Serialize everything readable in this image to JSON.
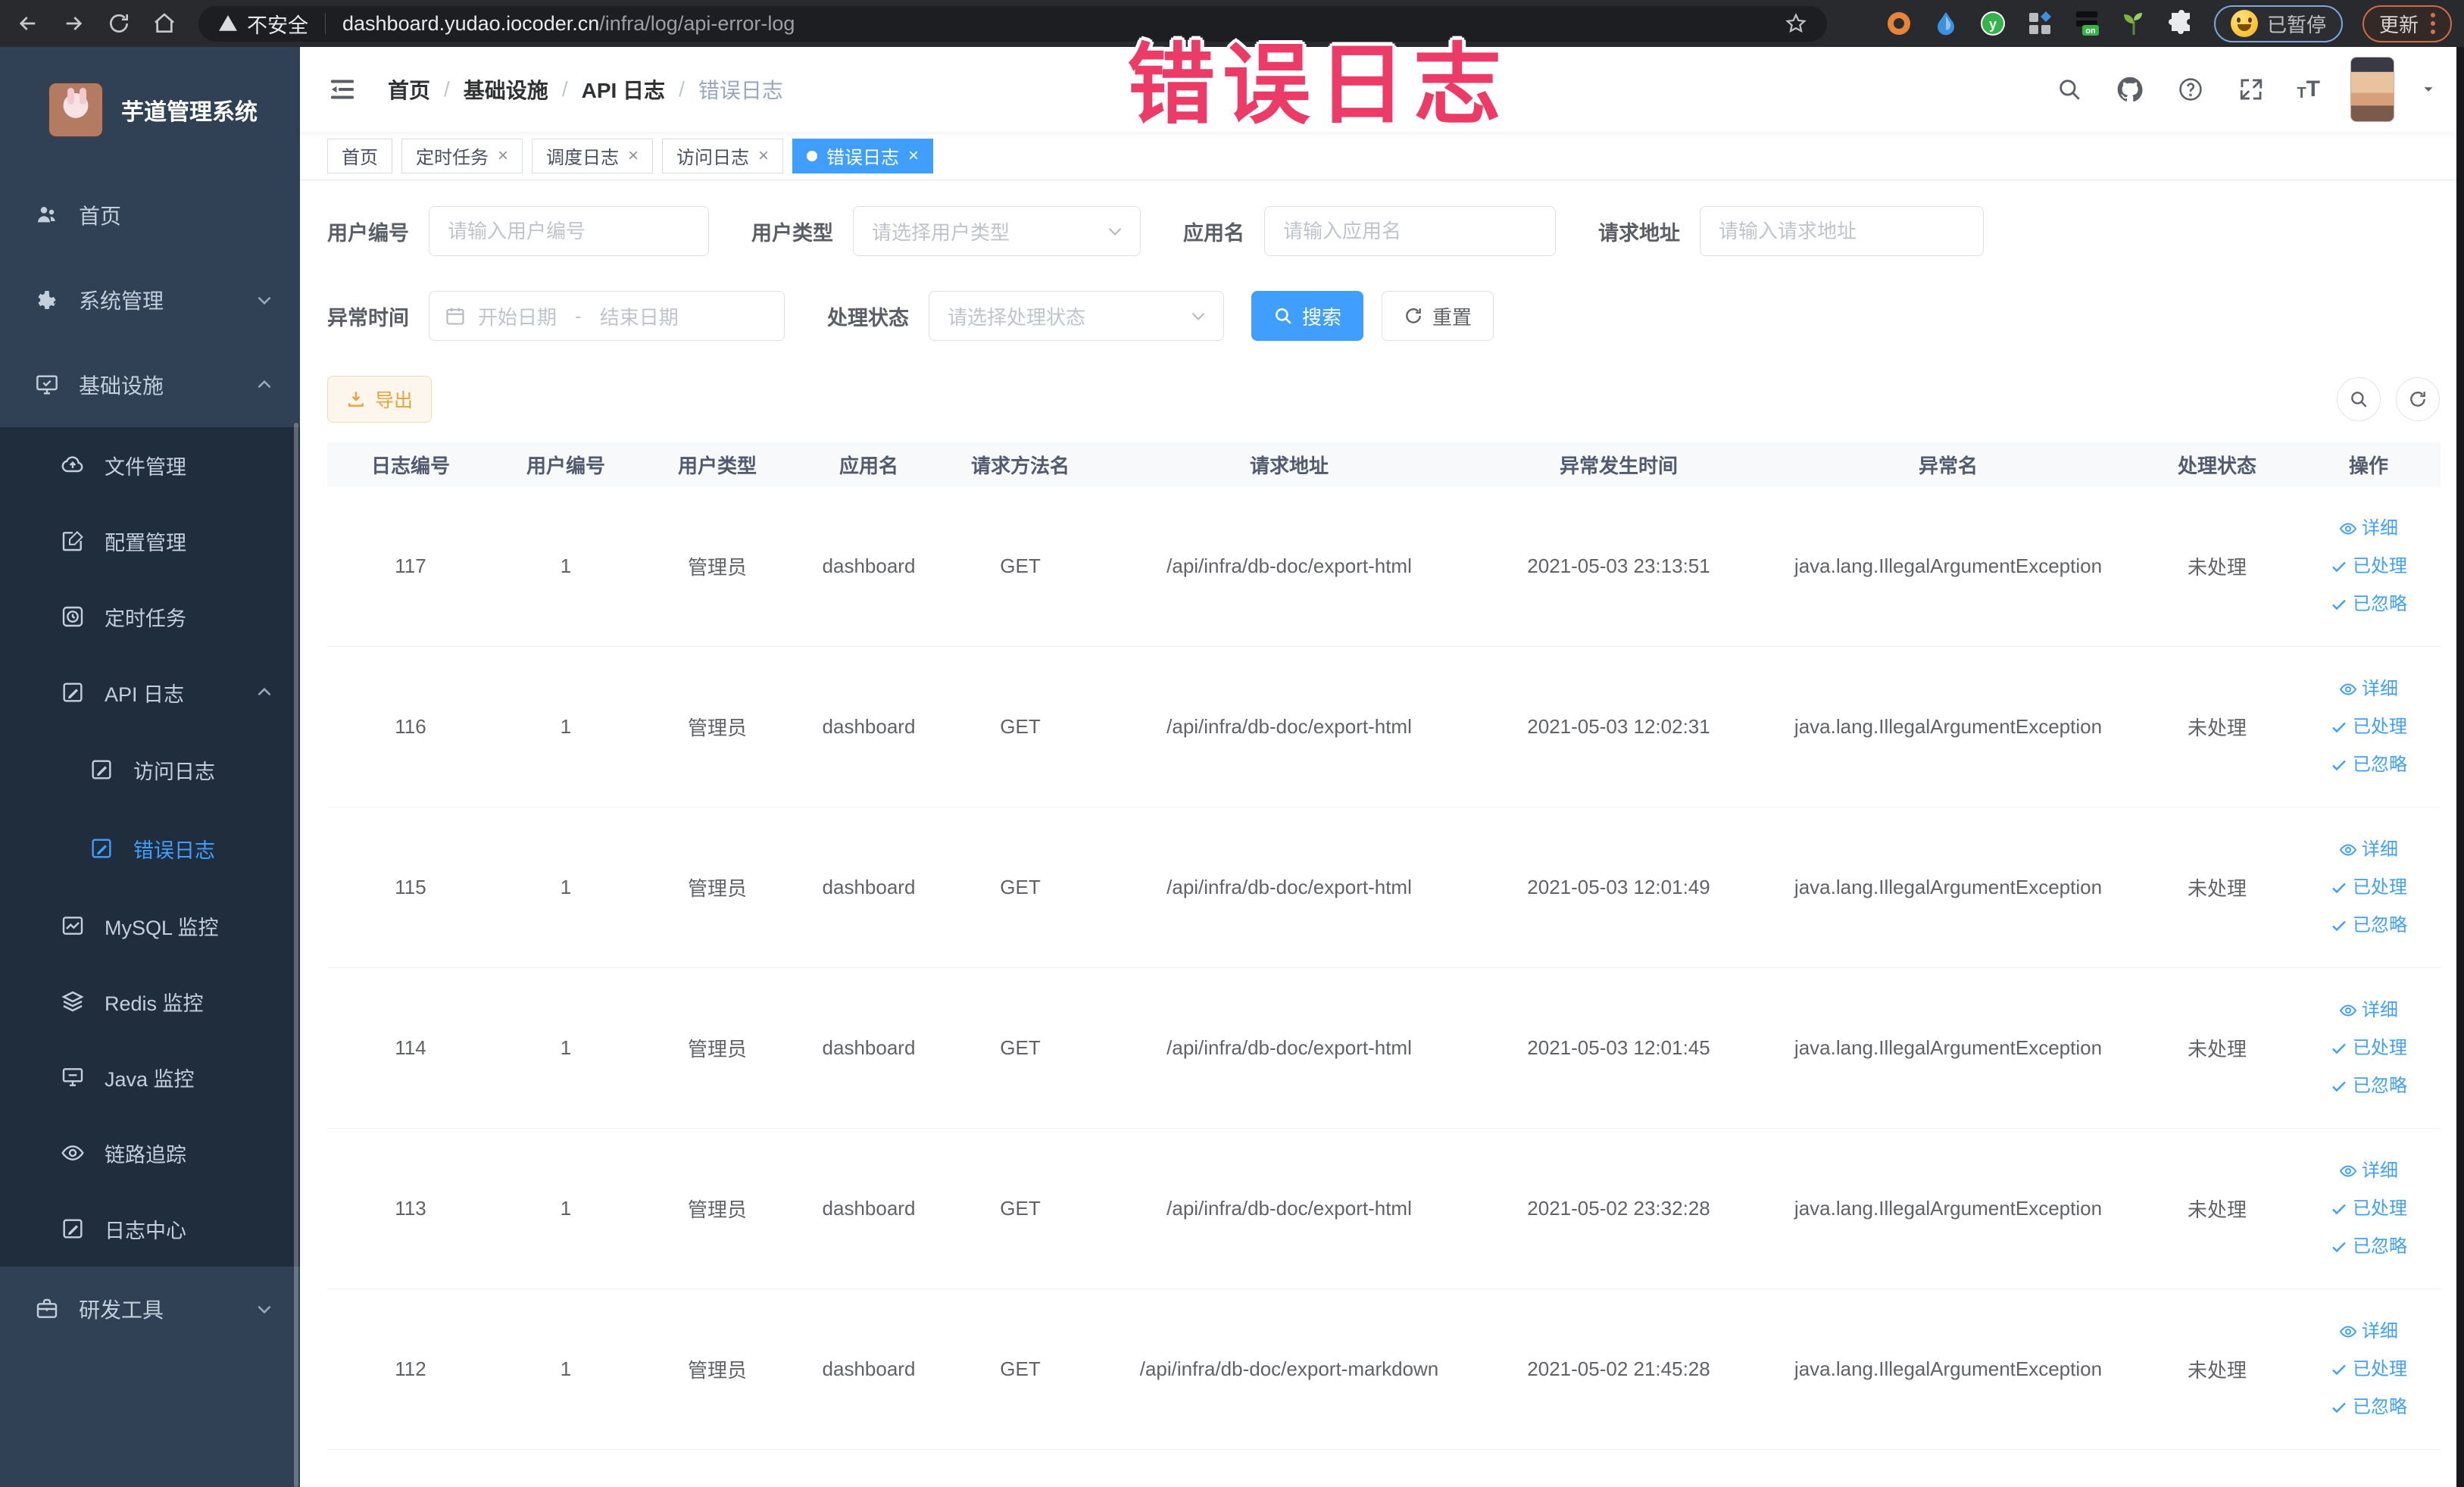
{
  "browser": {
    "security_label": "不安全",
    "url_domain": "dashboard.yudao.iocoder.cn",
    "url_path": "/infra/log/api-error-log",
    "paused_label": "已暂停",
    "update_label": "更新"
  },
  "watermark": {
    "text": "错误日志"
  },
  "sidebar": {
    "logo_title": "芋道管理系统",
    "items": [
      {
        "label": "首页"
      },
      {
        "label": "系统管理"
      },
      {
        "label": "基础设施"
      },
      {
        "label": "文件管理"
      },
      {
        "label": "配置管理"
      },
      {
        "label": "定时任务"
      },
      {
        "label": "API 日志"
      },
      {
        "label": "访问日志"
      },
      {
        "label": "错误日志"
      },
      {
        "label": "MySQL 监控"
      },
      {
        "label": "Redis 监控"
      },
      {
        "label": "Java 监控"
      },
      {
        "label": "链路追踪"
      },
      {
        "label": "日志中心"
      },
      {
        "label": "研发工具"
      }
    ]
  },
  "header": {
    "breadcrumb": [
      "首页",
      "基础设施",
      "API 日志",
      "错误日志"
    ]
  },
  "tabs": [
    {
      "label": "首页"
    },
    {
      "label": "定时任务"
    },
    {
      "label": "调度日志"
    },
    {
      "label": "访问日志"
    },
    {
      "label": "错误日志"
    }
  ],
  "filters": {
    "user_id_label": "用户编号",
    "user_id_placeholder": "请输入用户编号",
    "user_type_label": "用户类型",
    "user_type_placeholder": "请选择用户类型",
    "app_name_label": "应用名",
    "app_name_placeholder": "请输入应用名",
    "request_url_label": "请求地址",
    "request_url_placeholder": "请输入请求地址",
    "exception_time_label": "异常时间",
    "start_date_placeholder": "开始日期",
    "date_separator": "-",
    "end_date_placeholder": "结束日期",
    "process_status_label": "处理状态",
    "process_status_placeholder": "请选择处理状态",
    "search_label": "搜索",
    "reset_label": "重置"
  },
  "toolbar": {
    "export_label": "导出"
  },
  "table": {
    "headers": [
      "日志编号",
      "用户编号",
      "用户类型",
      "应用名",
      "请求方法名",
      "请求地址",
      "异常发生时间",
      "异常名",
      "处理状态",
      "操作"
    ],
    "action_labels": {
      "detail": "详细",
      "processed": "已处理",
      "ignored": "已忽略"
    },
    "rows": [
      {
        "id": "117",
        "user_id": "1",
        "user_type": "管理员",
        "app_name": "dashboard",
        "method": "GET",
        "url": "/api/infra/db-doc/export-html",
        "time": "2021-05-03 23:13:51",
        "exception": "java.lang.IllegalArgumentException",
        "status": "未处理"
      },
      {
        "id": "116",
        "user_id": "1",
        "user_type": "管理员",
        "app_name": "dashboard",
        "method": "GET",
        "url": "/api/infra/db-doc/export-html",
        "time": "2021-05-03 12:02:31",
        "exception": "java.lang.IllegalArgumentException",
        "status": "未处理"
      },
      {
        "id": "115",
        "user_id": "1",
        "user_type": "管理员",
        "app_name": "dashboard",
        "method": "GET",
        "url": "/api/infra/db-doc/export-html",
        "time": "2021-05-03 12:01:49",
        "exception": "java.lang.IllegalArgumentException",
        "status": "未处理"
      },
      {
        "id": "114",
        "user_id": "1",
        "user_type": "管理员",
        "app_name": "dashboard",
        "method": "GET",
        "url": "/api/infra/db-doc/export-html",
        "time": "2021-05-03 12:01:45",
        "exception": "java.lang.IllegalArgumentException",
        "status": "未处理"
      },
      {
        "id": "113",
        "user_id": "1",
        "user_type": "管理员",
        "app_name": "dashboard",
        "method": "GET",
        "url": "/api/infra/db-doc/export-html",
        "time": "2021-05-02 23:32:28",
        "exception": "java.lang.IllegalArgumentException",
        "status": "未处理"
      },
      {
        "id": "112",
        "user_id": "1",
        "user_type": "管理员",
        "app_name": "dashboard",
        "method": "GET",
        "url": "/api/infra/db-doc/export-markdown",
        "time": "2021-05-02 21:45:28",
        "exception": "java.lang.IllegalArgumentException",
        "status": "未处理"
      }
    ]
  },
  "colors": {
    "accent": "#409eff",
    "active_tab_bg": "#409eff",
    "link": "#409eff",
    "watermark_pink": "#ec3b66",
    "export_warning": "#e6a23c",
    "sidebar_bg": "#304156",
    "submenu_bg": "#1f2d3d",
    "browser_bar_bg": "#282a2e"
  }
}
